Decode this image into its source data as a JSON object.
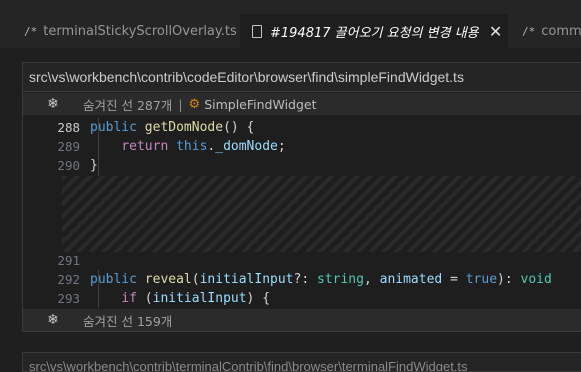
{
  "tabs": [
    {
      "icon": "/*",
      "label": "terminalStickyScrollOverlay.ts",
      "active": false
    },
    {
      "icon": "file-icon",
      "label": "#194817 끌어오기 요청의 변경 내용",
      "active": true,
      "close": "✕"
    },
    {
      "icon": "/*",
      "label": "comma",
      "active": false
    }
  ],
  "file": {
    "path": "src\\vs\\workbench\\contrib\\codeEditor\\browser\\find\\simpleFindWidget.ts"
  },
  "hidden_top": {
    "text": "숨겨진 선 287개",
    "separator": "|",
    "symbol": "SimpleFindWidget"
  },
  "hidden_bottom": {
    "text": "숨겨진 선 159개"
  },
  "code_lines": [
    {
      "num": "288"
    },
    {
      "num": "289"
    },
    {
      "num": "290"
    },
    {
      "num": "291"
    },
    {
      "num": "292"
    },
    {
      "num": "293"
    }
  ],
  "next_block": {
    "path": "src\\vs\\workbench\\contrib\\terminalContrib\\find\\browser\\terminalFindWidget.ts"
  }
}
